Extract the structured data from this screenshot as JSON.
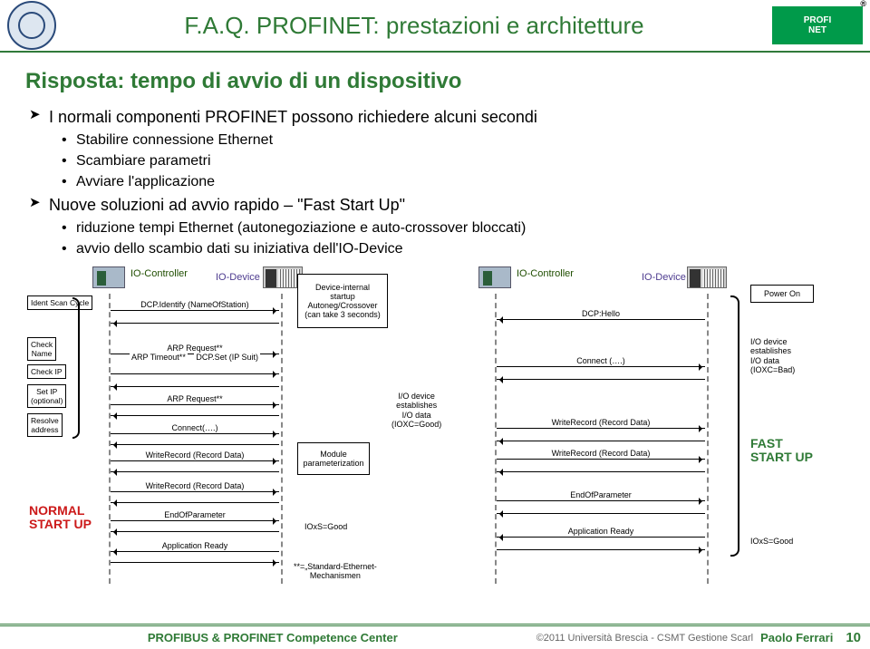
{
  "header": {
    "title": "F.A.Q. PROFINET: prestazioni e architetture",
    "logo_top": "PROFI",
    "logo_bottom": "NET",
    "registered": "®"
  },
  "heading": "Risposta: tempo di avvio di un dispositivo",
  "bullets": {
    "a1": "I normali componenti PROFINET possono richiedere alcuni secondi",
    "a1_1": "Stabilire connessione Ethernet",
    "a1_2": "Scambiare parametri",
    "a1_3": "Avviare l'applicazione",
    "a2": "Nuove soluzioni ad avvio rapido – \"Fast Start Up\"",
    "a2_1": "riduzione tempi Ethernet (autonegoziazione e auto-crossover bloccati)",
    "a2_2": "avvio dello scambio dati su iniziativa dell'IO-Device"
  },
  "diagram": {
    "roles": {
      "io_controller": "IO-Controller",
      "io_device": "IO-Device"
    },
    "left_steps": {
      "ident": "Ident Scan Cycle",
      "check_name": "Check\nName",
      "check_ip": "Check IP",
      "set_ip": "Set IP\n(optional)",
      "resolve": "Resolve\naddress"
    },
    "messages_left": {
      "m1": "DCP.Identify (NameOfStation)",
      "m2": "ARP Request**",
      "m3_a": "ARP Timeout**",
      "m3_b": "DCP.Set (IP Suit)",
      "m4": "ARP Request**",
      "m5": "Connect(….)",
      "m6": "WriteRecord (Record Data)",
      "m7": "WriteRecord (Record Data)",
      "m8": "EndOfParameter",
      "m9": "Application Ready"
    },
    "center_boxes": {
      "dev_startup": "Device-internal\nstartup\nAutoneg/Crossover\n(can take 3 seconds)",
      "module_param": "Module\nparameterization",
      "ioxs_good_l": "IOxS=Good",
      "std_eth": "**=„Standard-Ethernet-\nMechanismen"
    },
    "io_establish_left": "I/O device\nestablishes\nI/O data\n(IOXC=Good)",
    "messages_right": {
      "m1": "DCP:Hello",
      "m2": "Connect (….)",
      "m3": "WriteRecord (Record Data)",
      "m4": "WriteRecord (Record Data)",
      "m5": "EndOfParameter",
      "m6": "Application Ready"
    },
    "right_notes": {
      "power_on": "Power On",
      "io_establish": "I/O device\nestablishes\nI/O data\n(IOXC=Bad)",
      "ioxs_good_r": "IOxS=Good"
    },
    "labels": {
      "normal": "NORMAL\nSTART UP",
      "fast": "FAST\nSTART UP"
    }
  },
  "footer": {
    "center": "PROFIBUS & PROFINET Competence Center",
    "copyright": "©2011 Università Brescia - CSMT Gestione Scarl",
    "author": "Paolo Ferrari",
    "page": "10"
  }
}
